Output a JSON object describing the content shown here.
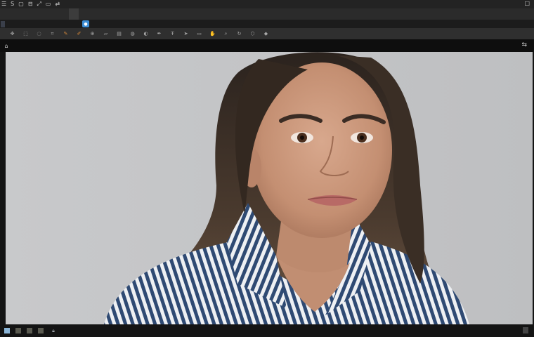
{
  "titlebar": {
    "items": [
      "☰",
      "S",
      "▢",
      "⊟",
      "⤢",
      "▭",
      "⇄"
    ],
    "window_control": "□"
  },
  "menubar": {
    "items": [
      "",
      "",
      "",
      "",
      "",
      "",
      "",
      ""
    ]
  },
  "options": {
    "path": "",
    "value": ""
  },
  "toolbar": {
    "icons": [
      "move-icon",
      "marquee-icon",
      "lasso-icon",
      "crop-icon",
      "eyedropper-icon",
      "brush-icon",
      "clone-icon",
      "eraser-icon",
      "gradient-icon",
      "blur-icon",
      "dodge-icon",
      "pen-icon",
      "type-icon",
      "path-select-icon",
      "shape-icon",
      "hand-icon",
      "zoom-icon",
      "rotate-icon",
      "frame-icon",
      "hue-icon"
    ]
  },
  "document": {
    "tabs": [
      "",
      "",
      "",
      ""
    ]
  },
  "colors": {
    "accent": "#3d8ed6",
    "canvas_bg": "#c6c7c9",
    "shirt_stripe": "#2f4a73",
    "hair": "#4a3a2e",
    "skin": "#c9967a"
  }
}
